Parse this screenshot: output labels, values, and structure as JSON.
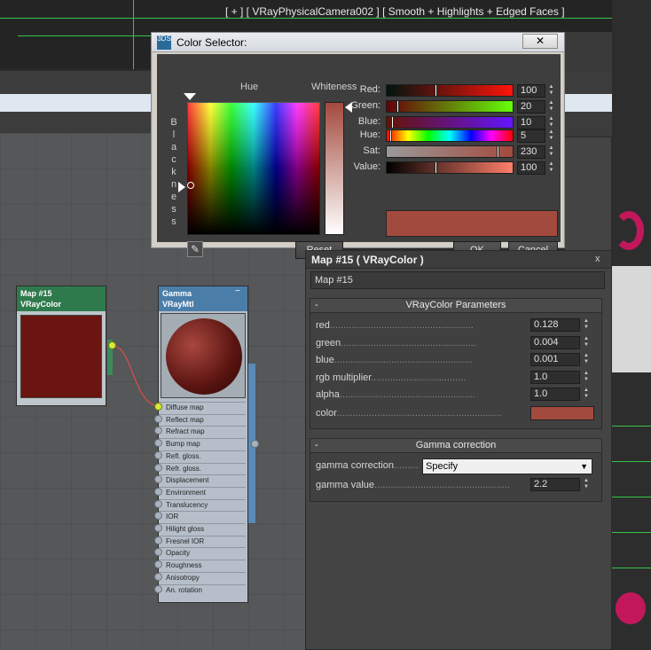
{
  "viewport": {
    "label": "[ + ] [ VRayPhysicalCamera002 ] [ Smooth + Highlights + Edged Faces ]"
  },
  "color_selector": {
    "title": "Color Selector:",
    "logo_text": "3DS",
    "close_label": "✕",
    "hue_label": "Hue",
    "whiteness_label": "Whiteness",
    "blackness_label": "Blackness",
    "eyedropper_icon": "eyedropper-icon",
    "reset_label": "Reset",
    "ok_label": "OK",
    "cancel_label": "Cancel",
    "swatch_color": "#a34a3e",
    "channels": [
      {
        "label": "Red:",
        "value": "100",
        "fraction": 0.392
      },
      {
        "label": "Green:",
        "value": "20",
        "fraction": 0.078
      },
      {
        "label": "Blue:",
        "value": "10",
        "fraction": 0.039
      }
    ],
    "hsv": [
      {
        "label": "Hue:",
        "value": "5",
        "fraction": 0.02
      },
      {
        "label": "Sat:",
        "value": "230",
        "fraction": 0.9
      },
      {
        "label": "Value:",
        "value": "100",
        "fraction": 0.392
      }
    ]
  },
  "map_panel": {
    "title": "Map #15  ( VRayColor )",
    "close_label": "x",
    "name_field": "Map #15",
    "params_rollout": {
      "minus": "-",
      "title": "VRayColor Parameters",
      "rows": [
        {
          "label": "red",
          "value": "0.128"
        },
        {
          "label": "green",
          "value": "0.004"
        },
        {
          "label": "blue",
          "value": "0.001"
        },
        {
          "label": "rgb multiplier",
          "value": "1.0"
        },
        {
          "label": "alpha",
          "value": "1.0"
        }
      ],
      "color_label": "color",
      "color_value": "#a34a3e"
    },
    "gamma_rollout": {
      "minus": "-",
      "title": "Gamma correction",
      "correction_label": "gamma correction",
      "correction_value": "Specify",
      "gamma_label": "gamma value",
      "gamma_value": "2.2"
    }
  },
  "nodes": {
    "map_node": {
      "line1": "Map #15",
      "line2": "VRayColor",
      "swatch_color": "#6a1510"
    },
    "gamma_node": {
      "line1": "Gamma",
      "line2": "VRayMtl",
      "slots": [
        "Diffuse map",
        "Reflect map",
        "Refract map",
        "Bump map",
        "Refl. gloss.",
        "Refr. gloss.",
        "Displacement",
        "Environment",
        "Translucency",
        "IOR",
        "Hilight gloss",
        "Fresnel IOR",
        "Opacity",
        "Roughness",
        "Anisotropy",
        "An. rotation"
      ]
    }
  }
}
